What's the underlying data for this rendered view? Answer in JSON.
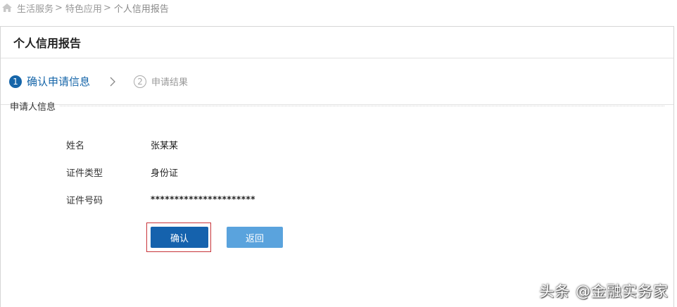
{
  "breadcrumb": {
    "items": [
      "生活服务",
      "特色应用"
    ],
    "separator": ">",
    "current": "个人信用报告"
  },
  "panel": {
    "title": "个人信用报告"
  },
  "steps": [
    {
      "number": "1",
      "label": "确认申请信息",
      "active": true
    },
    {
      "number": "2",
      "label": "申请结果",
      "active": false
    }
  ],
  "section": {
    "title": "申请人信息"
  },
  "fields": [
    {
      "label": "姓名",
      "value": "张某某"
    },
    {
      "label": "证件类型",
      "value": "身份证"
    },
    {
      "label": "证件号码",
      "value": "**********************"
    }
  ],
  "buttons": {
    "confirm_label": "确认",
    "back_label": "返回"
  },
  "watermark": {
    "text": "头条 @金融实务家"
  },
  "colors": {
    "primary": "#1562ad",
    "secondary_button": "#5aa3dd",
    "highlight_border": "#c8343a"
  }
}
